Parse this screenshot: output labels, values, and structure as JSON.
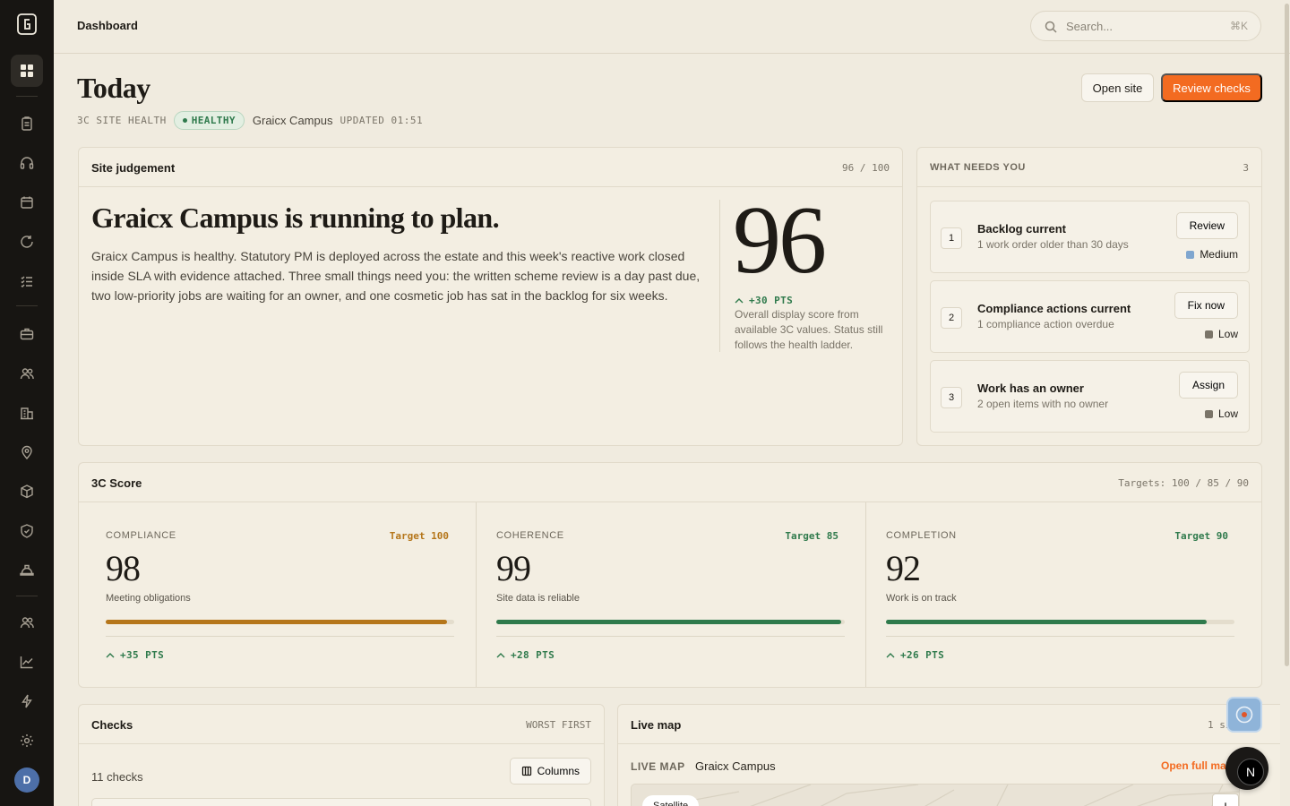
{
  "topbar": {
    "title": "Dashboard",
    "search_placeholder": "Search...",
    "search_shortcut": "⌘K"
  },
  "header": {
    "title": "Today",
    "meta_label": "3C SITE HEALTH",
    "status": "HEALTHY",
    "site": "Graicx Campus",
    "updated": "UPDATED 01:51",
    "open_site_label": "Open site",
    "review_checks_label": "Review checks"
  },
  "judgement": {
    "title": "Site judgement",
    "score_text": "96 / 100",
    "headline": "Graicx Campus is running to plan.",
    "body": "Graicx Campus is healthy. Statutory PM is deployed across the estate and this week's reactive work closed inside SLA with evidence attached. Three small things need you: the written scheme review is a day past due, two low-priority jobs are waiting for an owner, and one cosmetic job has sat in the backlog for six weeks.",
    "score": "96",
    "delta": "+30 PTS",
    "note": "Overall display score from available 3C values. Status still follows the health ladder."
  },
  "needs": {
    "title": "WHAT NEEDS YOU",
    "count": "3",
    "items": [
      {
        "num": "1",
        "title": "Backlog current",
        "sub": "1 work order older than 30 days",
        "action": "Review",
        "priority": "Medium",
        "priority_color": "#7fa6cf"
      },
      {
        "num": "2",
        "title": "Compliance actions current",
        "sub": "1 compliance action overdue",
        "action": "Fix now",
        "priority": "Low",
        "priority_color": "#7a7468"
      },
      {
        "num": "3",
        "title": "Work has an owner",
        "sub": "2 open items with no owner",
        "action": "Assign",
        "priority": "Low",
        "priority_color": "#7a7468"
      }
    ]
  },
  "score": {
    "title": "3C Score",
    "targets": "Targets: 100 / 85 / 90",
    "columns": [
      {
        "label": "COMPLIANCE",
        "target": "Target 100",
        "target_color": "#b5761a",
        "value": "98",
        "sub": "Meeting obligations",
        "fill_percent": 98,
        "bar_color": "#b5761a",
        "delta": "+35 PTS"
      },
      {
        "label": "COHERENCE",
        "target": "Target 85",
        "target_color": "#2f7a4c",
        "value": "99",
        "sub": "Site data is reliable",
        "fill_percent": 99,
        "bar_color": "#2f7a4c",
        "delta": "+28 PTS"
      },
      {
        "label": "COMPLETION",
        "target": "Target 90",
        "target_color": "#2f7a4c",
        "value": "92",
        "sub": "Work is on track",
        "fill_percent": 92,
        "bar_color": "#2f7a4c",
        "delta": "+26 PTS"
      }
    ]
  },
  "checks": {
    "title": "Checks",
    "sort": "WORST FIRST",
    "count": "11 checks",
    "columns_label": "Columns"
  },
  "map": {
    "title": "Live map",
    "right": "1 si",
    "label": "LIVE MAP",
    "site": "Graicx Campus",
    "open": "Open full ma",
    "satellite": "Satellite",
    "zoom_in": "+"
  },
  "user": {
    "initial": "D"
  },
  "fab": {
    "initial": "N"
  },
  "colors": {
    "accent": "#f36b21",
    "healthy": "#2f7a4c",
    "sidebar": "#171512",
    "background": "#f0ebdf"
  }
}
